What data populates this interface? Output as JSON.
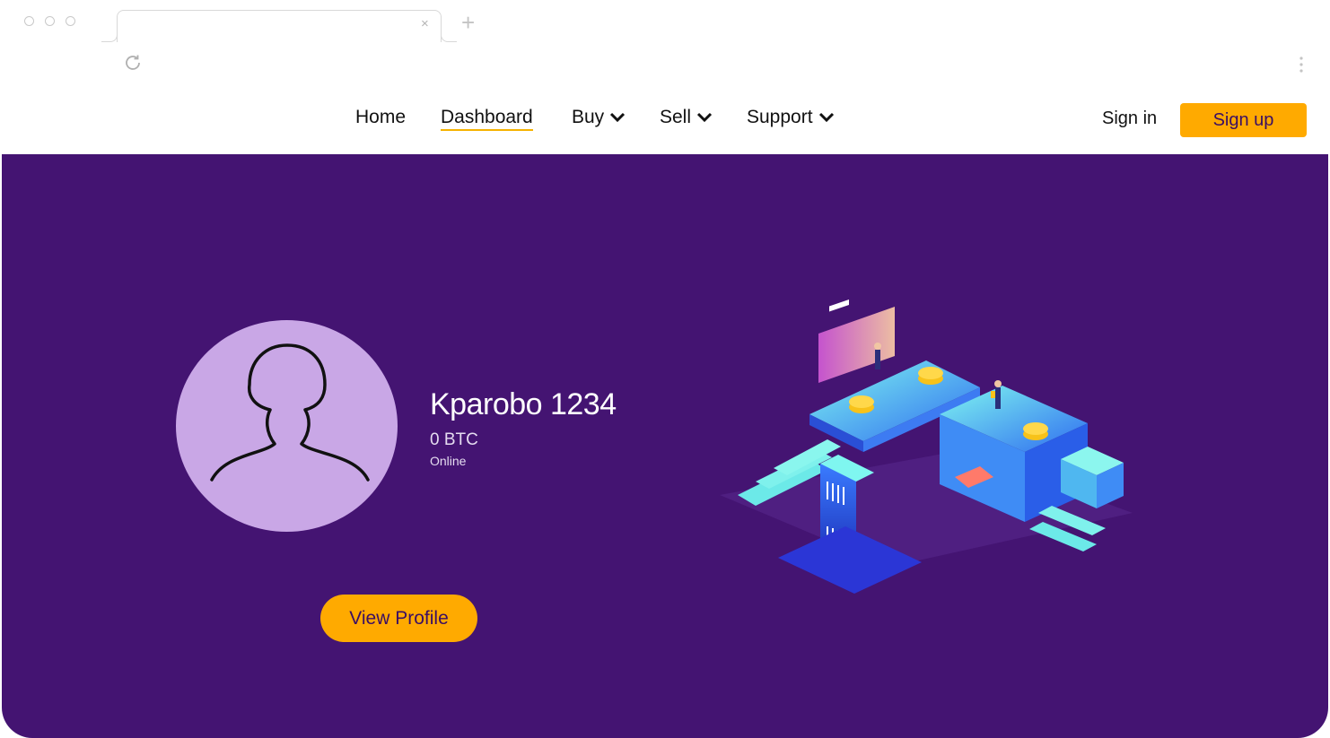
{
  "browser": {
    "tab_close": "×",
    "new_tab": "+",
    "icons": [
      "reload-icon",
      "kebab-menu-icon"
    ]
  },
  "nav": {
    "links": [
      {
        "label": "Home",
        "active": false
      },
      {
        "label": "Dashboard",
        "active": true
      },
      {
        "label": "Buy",
        "has_dropdown": true
      },
      {
        "label": "Sell",
        "has_dropdown": true
      },
      {
        "label": "Support",
        "has_dropdown": true
      }
    ],
    "sign_in": "Sign in",
    "sign_up": "Sign up"
  },
  "profile": {
    "username": "Kparobo 1234",
    "balance": "0 BTC",
    "status": "Online",
    "view_profile_label": "View Profile",
    "avatar_icon": "user-silhouette-icon"
  },
  "colors": {
    "hero_bg": "#441472",
    "accent": "#ffaa00",
    "avatar_bg": "#c9a7e6",
    "button_text": "#3a0e64"
  }
}
